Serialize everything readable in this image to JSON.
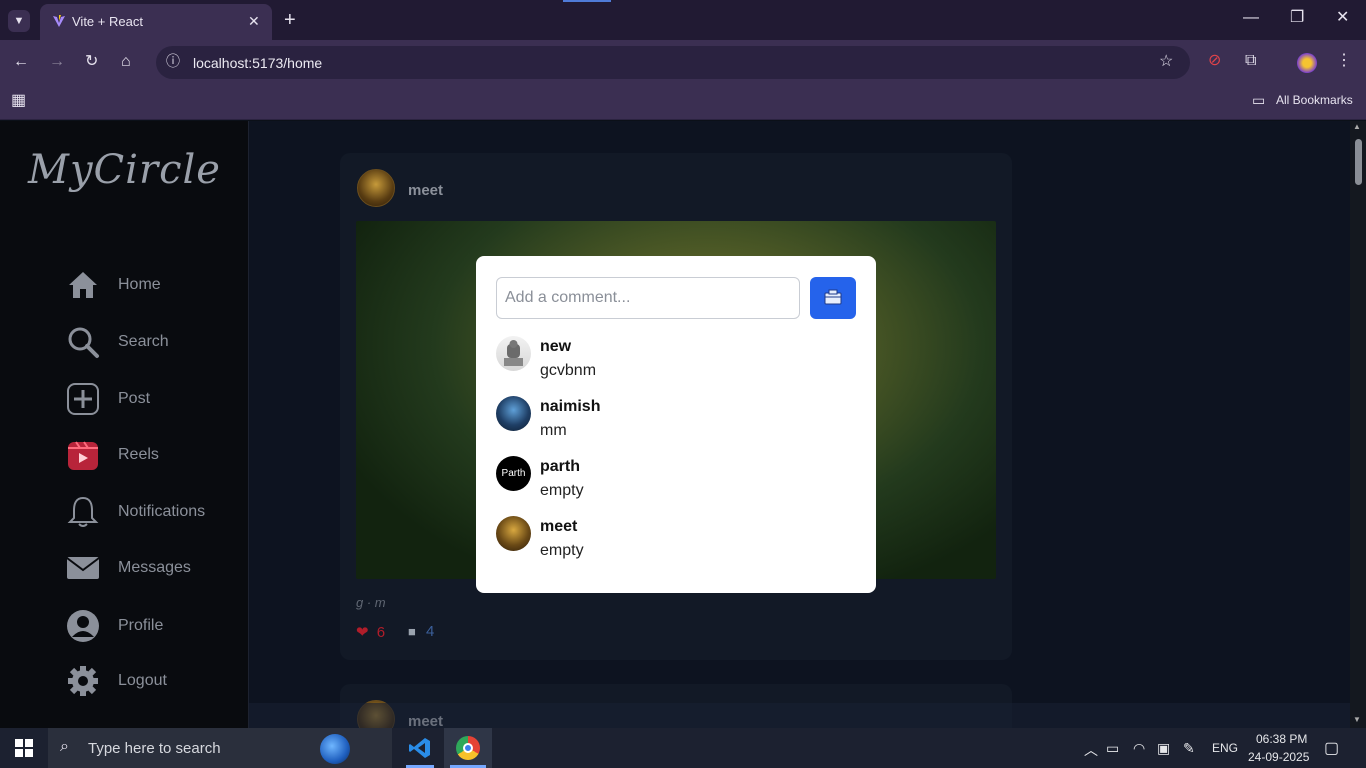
{
  "browser": {
    "tab_title": "Vite + React",
    "url": "localhost:5173/home",
    "bookmarks_label": "All Bookmarks"
  },
  "app": {
    "logo": "MyCircle",
    "nav": [
      {
        "label": "Home",
        "icon": "home-icon"
      },
      {
        "label": "Search",
        "icon": "search-icon"
      },
      {
        "label": "Post",
        "icon": "plus-square-icon"
      },
      {
        "label": "Reels",
        "icon": "reels-icon"
      },
      {
        "label": "Notifications",
        "icon": "bell-icon"
      },
      {
        "label": "Messages",
        "icon": "envelope-icon"
      },
      {
        "label": "Profile",
        "icon": "user-icon"
      },
      {
        "label": "Logout",
        "icon": "gear-icon"
      }
    ]
  },
  "feed": {
    "post1": {
      "username": "meet",
      "caption": "g · m",
      "likes": "6",
      "comments": "4"
    },
    "post2": {
      "username": "meet"
    }
  },
  "modal": {
    "placeholder": "Add a comment...",
    "comments": [
      {
        "user": "new",
        "text": "gcvbnm"
      },
      {
        "user": "naimish",
        "text": "mm"
      },
      {
        "user": "parth",
        "text": "empty",
        "avatar_text": "Parth"
      },
      {
        "user": "meet",
        "text": "empty"
      }
    ]
  },
  "taskbar": {
    "search_placeholder": "Type here to search",
    "language": "ENG",
    "time": "06:38 PM",
    "date": "24-09-2025"
  },
  "colors": {
    "accent": "#2563eb",
    "like": "#b01d2a",
    "chrome": "#3b2f52"
  }
}
